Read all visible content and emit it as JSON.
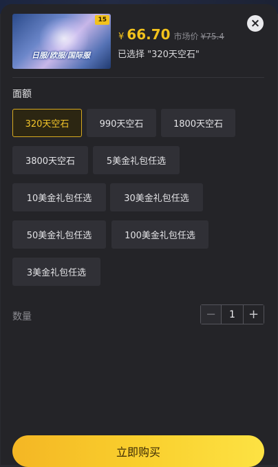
{
  "product": {
    "image_badge": "15",
    "image_caption": "日服/欧服/国际服",
    "currency_symbol": "¥",
    "price": "66.70",
    "market_label": "市场价",
    "market_price": "¥75.4",
    "selected_text": "已选择 \"320天空石\""
  },
  "options": {
    "section_title": "面额",
    "items": [
      {
        "label": "320天空石",
        "selected": true
      },
      {
        "label": "990天空石",
        "selected": false
      },
      {
        "label": "1800天空石",
        "selected": false
      },
      {
        "label": "3800天空石",
        "selected": false
      },
      {
        "label": "5美金礼包任选",
        "selected": false
      },
      {
        "label": "10美金礼包任选",
        "selected": false
      },
      {
        "label": "30美金礼包任选",
        "selected": false
      },
      {
        "label": "50美金礼包任选",
        "selected": false
      },
      {
        "label": "100美金礼包任选",
        "selected": false
      },
      {
        "label": "3美金礼包任选",
        "selected": false
      }
    ]
  },
  "quantity": {
    "label": "数量",
    "minus_symbol": "−",
    "value": "1",
    "plus_symbol": "+"
  },
  "close_symbol": "×",
  "buy_button_label": "立即购买",
  "colors": {
    "accent": "#f2c21c",
    "sheet_background": "#242428",
    "option_background": "#303036"
  }
}
